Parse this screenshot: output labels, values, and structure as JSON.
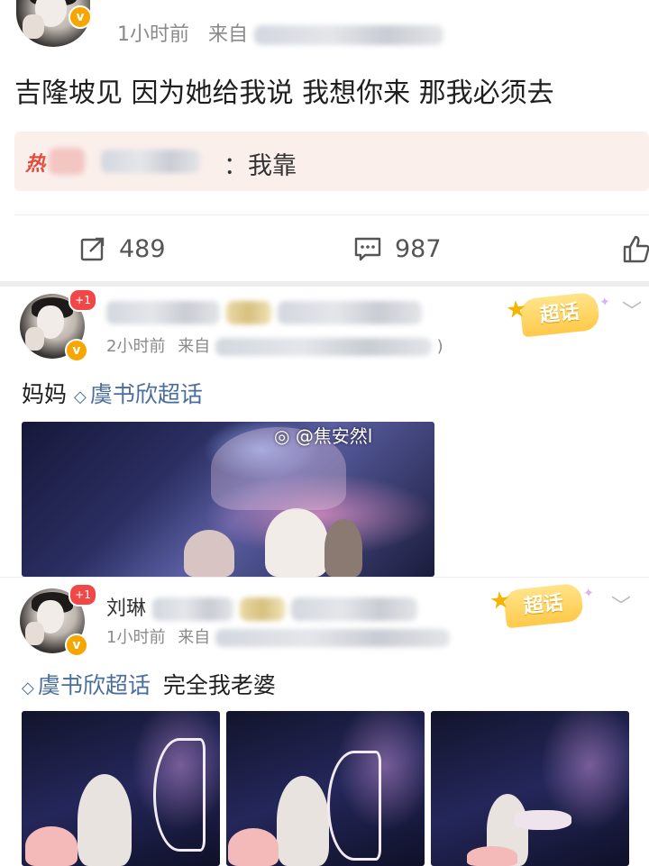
{
  "post1": {
    "time": "1小时前",
    "source_prefix": "来自",
    "text": "吉隆坡见 因为她给我说 我想你来 那我必须去",
    "hot_comment": {
      "tag": "热",
      "text": "：我靠"
    },
    "actions": {
      "repost_count": "489",
      "comment_count": "987"
    }
  },
  "post2": {
    "badge": "+1",
    "time": "2小时前",
    "source_prefix": "来自",
    "super_topic_tag": "超话",
    "text_plain": "妈妈",
    "topic": "虞书欣超话",
    "watermark": "@焦安然l"
  },
  "post3": {
    "badge": "+1",
    "username_visible": "刘琳",
    "time": "1小时前",
    "source_prefix": "来自",
    "super_topic_tag": "超话",
    "topic": "虞书欣超话",
    "text_plain": "完全我老婆"
  },
  "icons": {
    "verified": "v-badge",
    "repost": "repost-icon",
    "comment": "comment-icon",
    "like": "like-icon",
    "super_topic": "diamond-icon",
    "chevron": "chevron-down-icon"
  },
  "colors": {
    "topic_link": "#4a6e9c",
    "verified_badge": "#f7a600",
    "hot_tag": "#e64a3c",
    "notification_badge": "#f04848",
    "super_tag": "#ffc94a"
  }
}
